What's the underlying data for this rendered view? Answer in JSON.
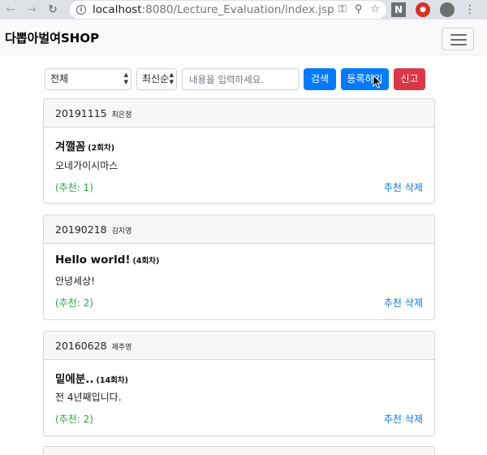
{
  "browser": {
    "url_host": "localhost",
    "url_path": ":8080/Lecture_Evaluation/index.jsp"
  },
  "navbar": {
    "brand": "다뽑아벌여SHOP"
  },
  "search": {
    "division_selected": "전체",
    "order_selected": "최신순",
    "placeholder": "내용을 입력하세요.",
    "search_label": "검색",
    "register_label": "등록하기",
    "report_label": "신고"
  },
  "evaluations": [
    {
      "date": "20191115",
      "author": "최은정",
      "title": "겨깰꼼",
      "round": "(2회차)",
      "content": "오네가이시마스",
      "recommend": "(추천: 1)",
      "recommend_action": "추천",
      "delete_action": "삭제"
    },
    {
      "date": "20190218",
      "author": "김지영",
      "title": "Hello world!",
      "round": "(4회차)",
      "content": "안녕세상!",
      "recommend": "(추천: 2)",
      "recommend_action": "추천",
      "delete_action": "삭제"
    },
    {
      "date": "20160628",
      "author": "제주영",
      "title": "밑에분..",
      "round": "(14회차)",
      "content": "전 4년째입니다.",
      "recommend": "(추천: 2)",
      "recommend_action": "추천",
      "delete_action": "삭제"
    }
  ]
}
